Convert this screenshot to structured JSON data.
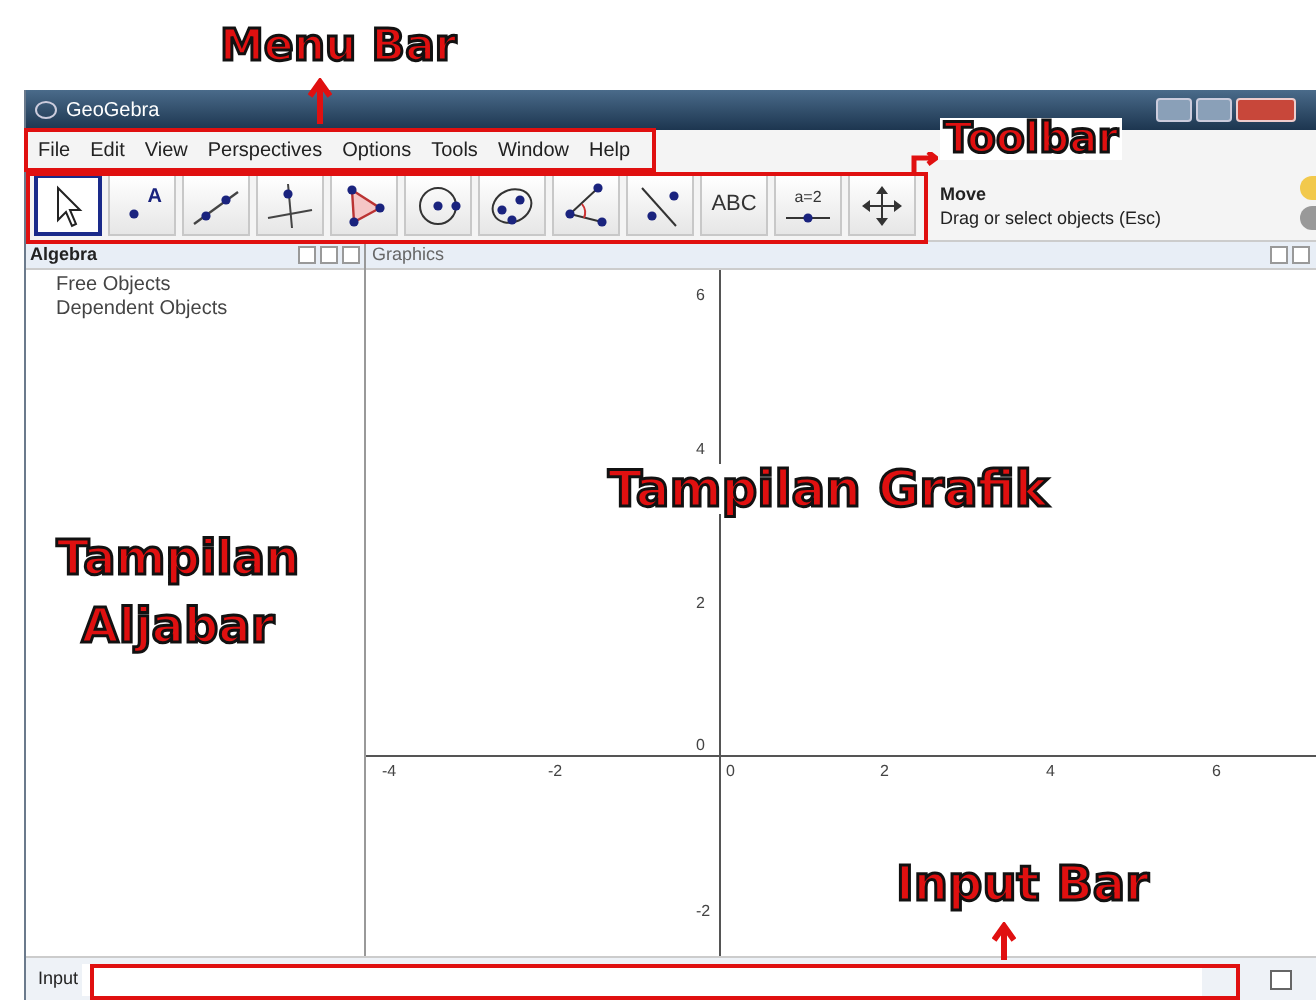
{
  "window": {
    "title": "GeoGebra"
  },
  "menu": [
    "File",
    "Edit",
    "View",
    "Perspectives",
    "Options",
    "Tools",
    "Window",
    "Help"
  ],
  "toolbar": {
    "tools": [
      {
        "kind": "move",
        "selected": true
      },
      {
        "kind": "point",
        "label": "A",
        "selected": false
      },
      {
        "kind": "line",
        "selected": false
      },
      {
        "kind": "perpendicular",
        "selected": false
      },
      {
        "kind": "polygon",
        "selected": false
      },
      {
        "kind": "circle",
        "selected": false
      },
      {
        "kind": "conic",
        "selected": false
      },
      {
        "kind": "angle",
        "selected": false
      },
      {
        "kind": "reflect",
        "selected": false
      },
      {
        "kind": "text",
        "label": "ABC",
        "selected": false
      },
      {
        "kind": "slider",
        "label": "a=2",
        "selected": false
      },
      {
        "kind": "pan",
        "selected": false
      }
    ],
    "help_title": "Move",
    "help_text": "Drag or select objects (Esc)"
  },
  "algebra": {
    "title": "Algebra",
    "items": [
      "Free Objects",
      "Dependent Objects"
    ]
  },
  "graphics": {
    "title": "Graphics",
    "x_tick_labels": [
      "-4",
      "-2",
      "0",
      "2",
      "4",
      "6"
    ],
    "y_tick_labels": [
      "6",
      "4",
      "2",
      "0",
      "-2"
    ]
  },
  "input_bar": {
    "label": "Input"
  },
  "annotations": [
    {
      "text": "Menu Bar"
    },
    {
      "text": "Toolbar"
    },
    {
      "text": "Tampilan Grafik"
    },
    {
      "text": "Tampilan Aljabar"
    },
    {
      "text": "Input Bar"
    }
  ]
}
